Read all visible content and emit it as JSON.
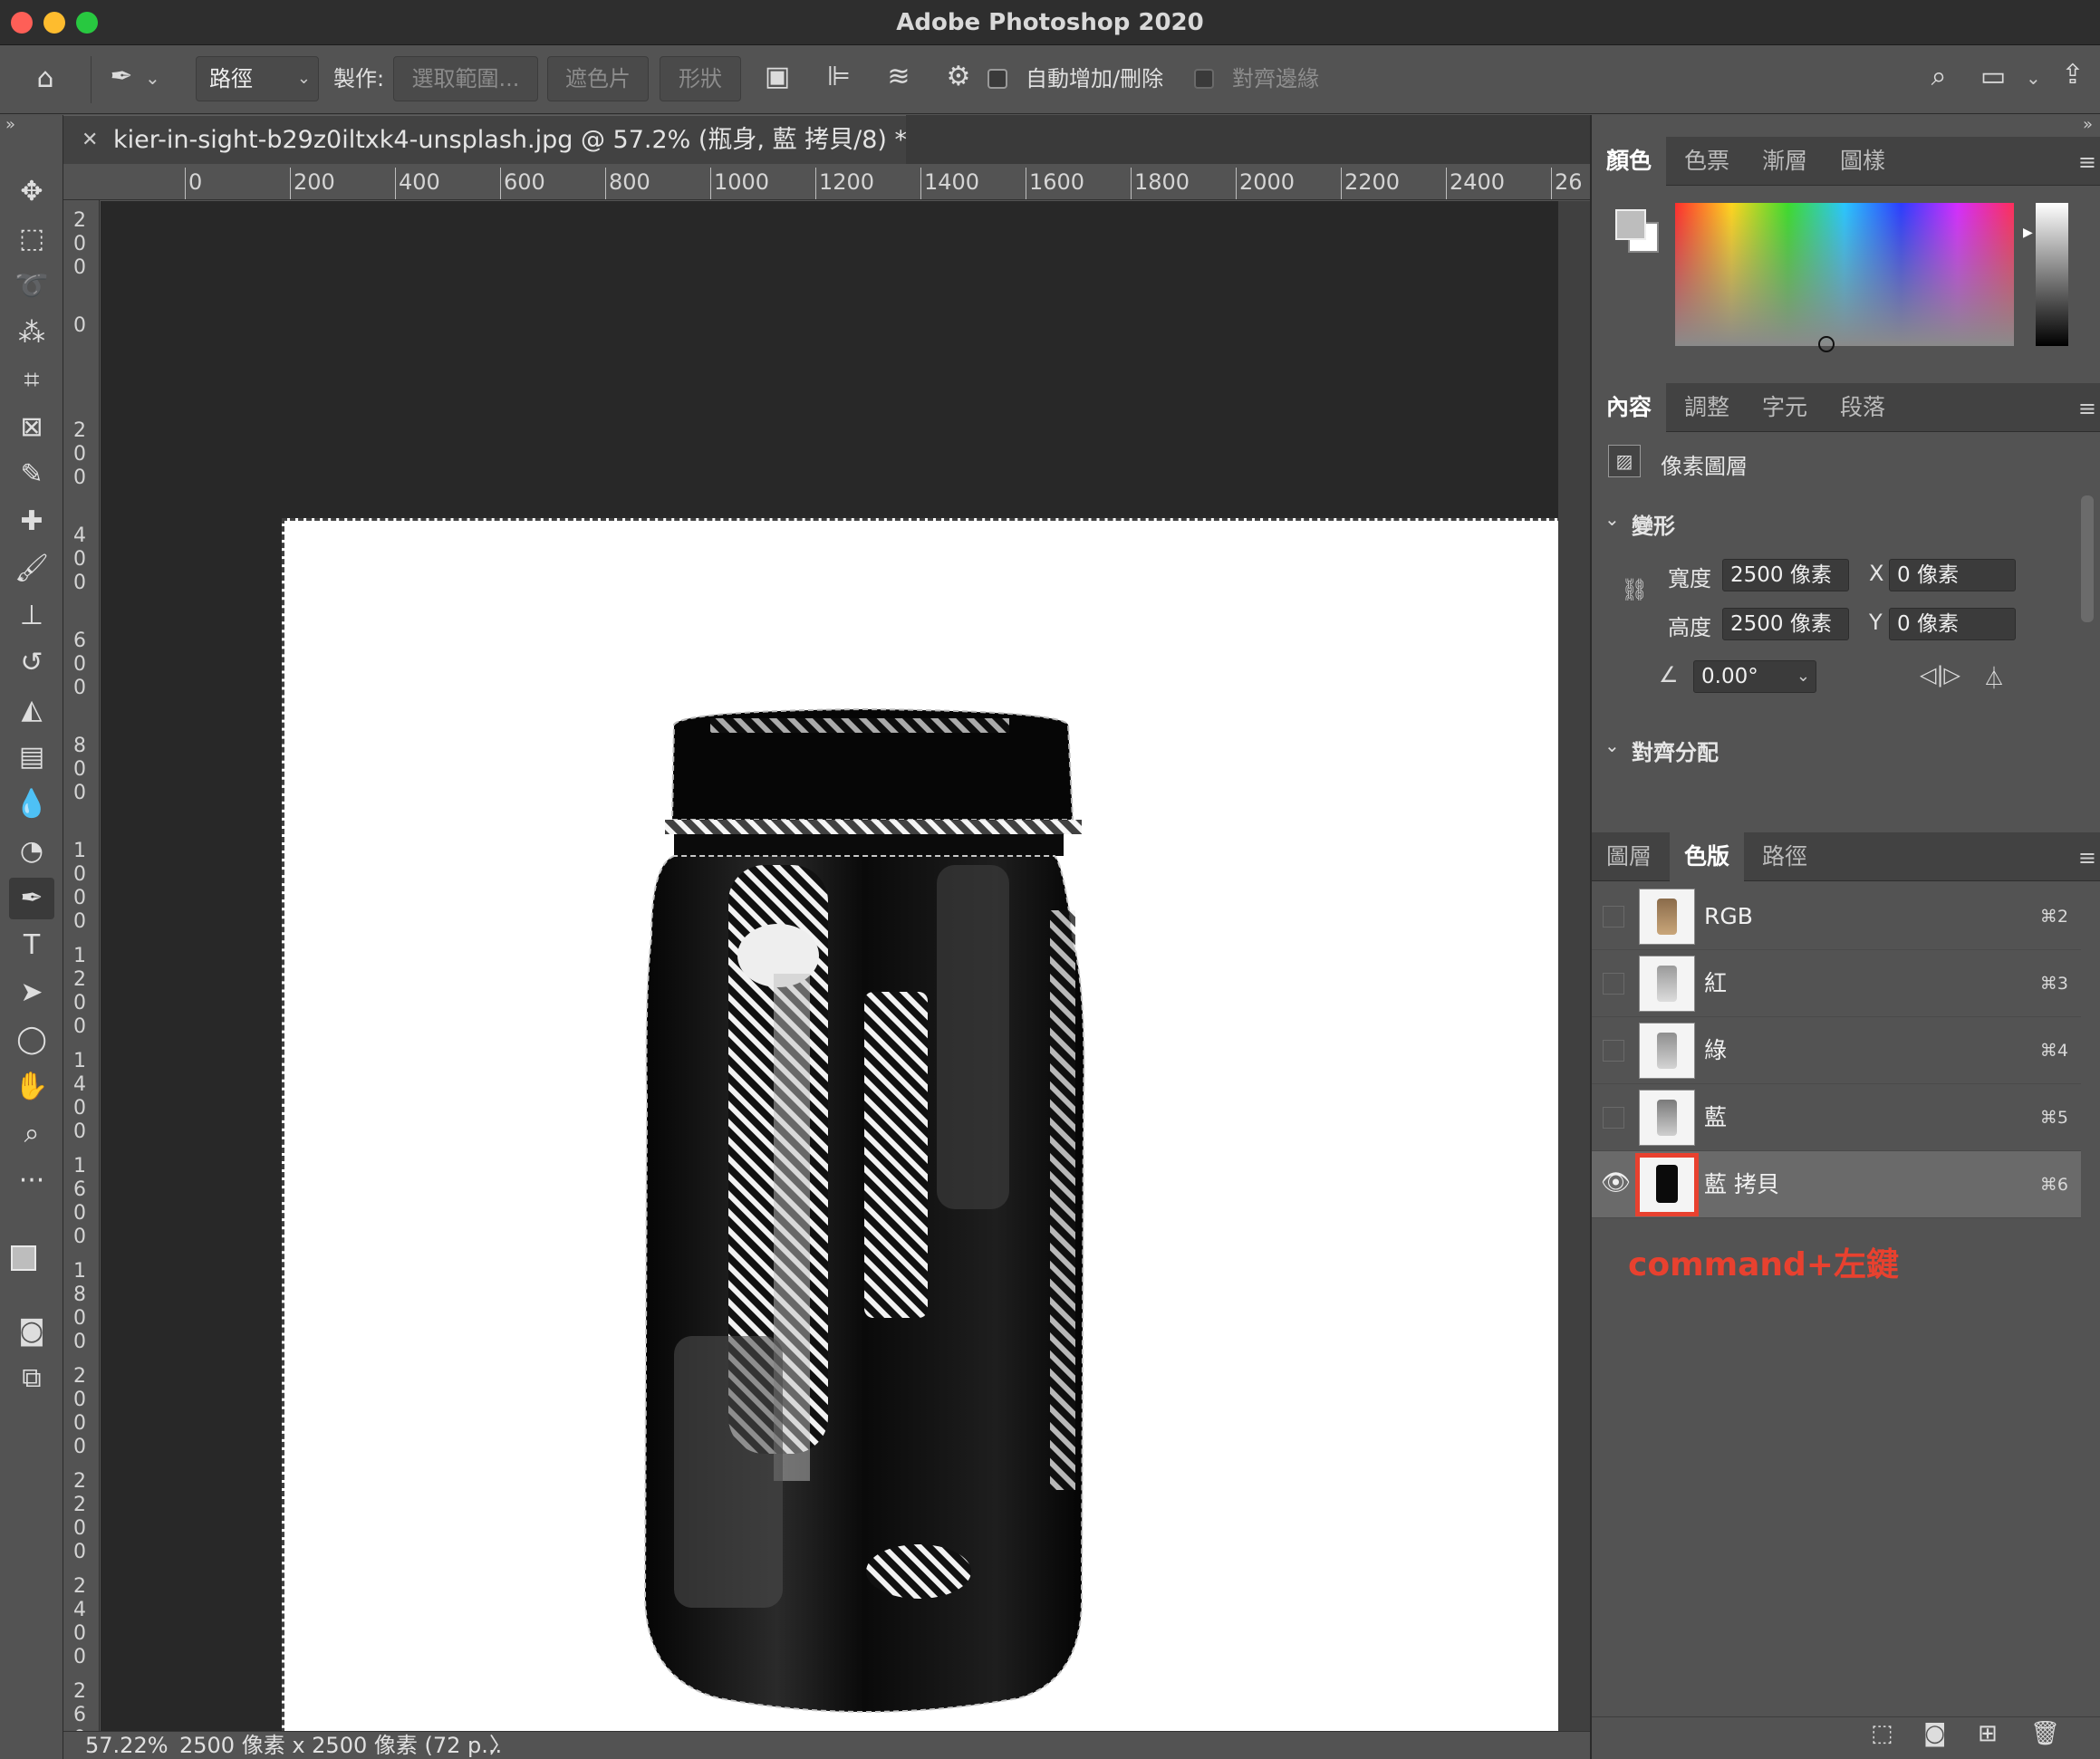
{
  "window": {
    "title": "Adobe Photoshop 2020"
  },
  "options_bar": {
    "mode_select": "路徑",
    "make_label": "製作:",
    "selection_button": "選取範圍...",
    "mask_button": "遮色片",
    "shape_button": "形狀",
    "auto_add_delete_label": "自動增加/刪除",
    "auto_add_delete_checked": false,
    "align_edges_label": "對齊邊緣",
    "align_edges_checked": false
  },
  "document": {
    "tab_title": "kier-in-sight-b29z0iltxk4-unsplash.jpg @ 57.2% (瓶身, 藍 拷貝/8) *",
    "hruler_labels": [
      "0",
      "200",
      "400",
      "600",
      "800",
      "1000",
      "1200",
      "1400",
      "1600",
      "1800",
      "2000",
      "2200",
      "2400",
      "26"
    ],
    "vruler_labels": [
      "200",
      "0",
      "200",
      "400",
      "600",
      "800",
      "1000",
      "1200",
      "1400",
      "1600",
      "1800",
      "2000",
      "2200",
      "2400",
      "260"
    ]
  },
  "status_bar": {
    "zoom": "57.22%",
    "doc_info": "2500 像素 x 2500 像素 (72 p...",
    "arrow": "〉"
  },
  "color_panel": {
    "tabs": [
      "顏色",
      "色票",
      "漸層",
      "圖樣"
    ],
    "active_tab": "顏色",
    "foreground_color": "#bdbdbd",
    "background_color": "#ffffff"
  },
  "properties_panel": {
    "tabs": [
      "內容",
      "調整",
      "字元",
      "段落"
    ],
    "active_tab": "內容",
    "layer_type": "像素圖層",
    "transform_section": "變形",
    "width_label": "寬度",
    "width_value": "2500 像素",
    "height_label": "高度",
    "height_value": "2500 像素",
    "x_label": "X",
    "x_value": "0 像素",
    "y_label": "Y",
    "y_value": "0 像素",
    "angle_value": "0.00°",
    "align_section": "對齊分配"
  },
  "channels_panel": {
    "tabs": [
      "圖層",
      "色版",
      "路徑"
    ],
    "active_tab": "色版",
    "rows": [
      {
        "name": "RGB",
        "shortcut": "⌘2",
        "visible": false,
        "selected": false
      },
      {
        "name": "紅",
        "shortcut": "⌘3",
        "visible": false,
        "selected": false
      },
      {
        "name": "綠",
        "shortcut": "⌘4",
        "visible": false,
        "selected": false
      },
      {
        "name": "藍",
        "shortcut": "⌘5",
        "visible": false,
        "selected": false
      },
      {
        "name": "藍 拷貝",
        "shortcut": "⌘6",
        "visible": true,
        "selected": true
      }
    ],
    "annotation": "command+左鍵",
    "annotation_color": "#e8412f"
  },
  "icons": [
    "home-icon",
    "pen-icon",
    "move-icon",
    "marquee-icon",
    "lasso-icon",
    "magic-wand-icon",
    "crop-icon",
    "frame-icon",
    "eyedropper-icon",
    "healing-icon",
    "brush-icon",
    "stamp-icon",
    "history-brush-icon",
    "eraser-icon",
    "gradient-icon",
    "blur-icon",
    "dodge-icon",
    "pen-tool-icon",
    "type-icon",
    "path-select-icon",
    "ellipse-icon",
    "hand-icon",
    "zoom-icon",
    "more-icon",
    "search-icon",
    "gear-icon",
    "share-icon",
    "eye-icon",
    "trash-icon"
  ]
}
